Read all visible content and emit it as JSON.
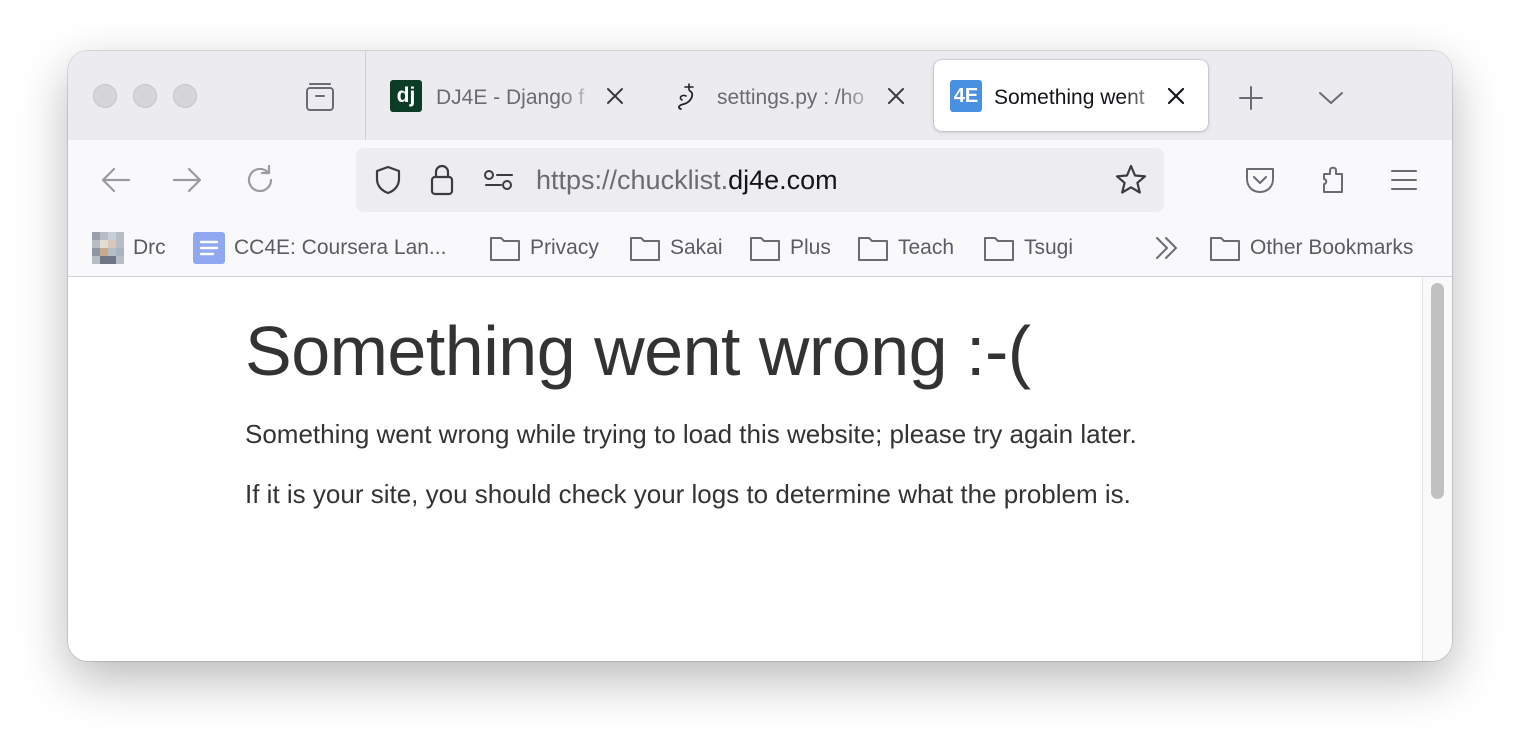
{
  "tabs": [
    {
      "title": "DJ4E - Django f",
      "favicon": "dj",
      "active": false
    },
    {
      "title": "settings.py : /ho",
      "favicon": "pythonanywhere-snake-icon",
      "active": false
    },
    {
      "title": "Something went",
      "favicon": "4E",
      "active": true
    }
  ],
  "colors": {
    "dj_favicon_bg": "#0c3c26",
    "fourE_favicon_bg": "#4a90e2",
    "cc4e_favicon_bg": "#8fa8f0"
  },
  "address": {
    "prefix": "https://chucklist.",
    "host": "dj4e.com"
  },
  "bookmarks": [
    {
      "label": "Drc",
      "icon": "pixel-avatar-icon"
    },
    {
      "label": "CC4E: Coursera Lan...",
      "icon": "document-icon"
    },
    {
      "label": "Privacy",
      "icon": "folder-icon"
    },
    {
      "label": "Sakai",
      "icon": "folder-icon"
    },
    {
      "label": "Plus",
      "icon": "folder-icon"
    },
    {
      "label": "Teach",
      "icon": "folder-icon"
    },
    {
      "label": "Tsugi",
      "icon": "folder-icon"
    }
  ],
  "other_bookmarks": "Other Bookmarks",
  "page": {
    "heading": "Something went wrong :-(",
    "message": "Something went wrong while trying to load this website; please try again later.",
    "hint": "If it is your site, you should check your logs to determine what the problem is."
  }
}
